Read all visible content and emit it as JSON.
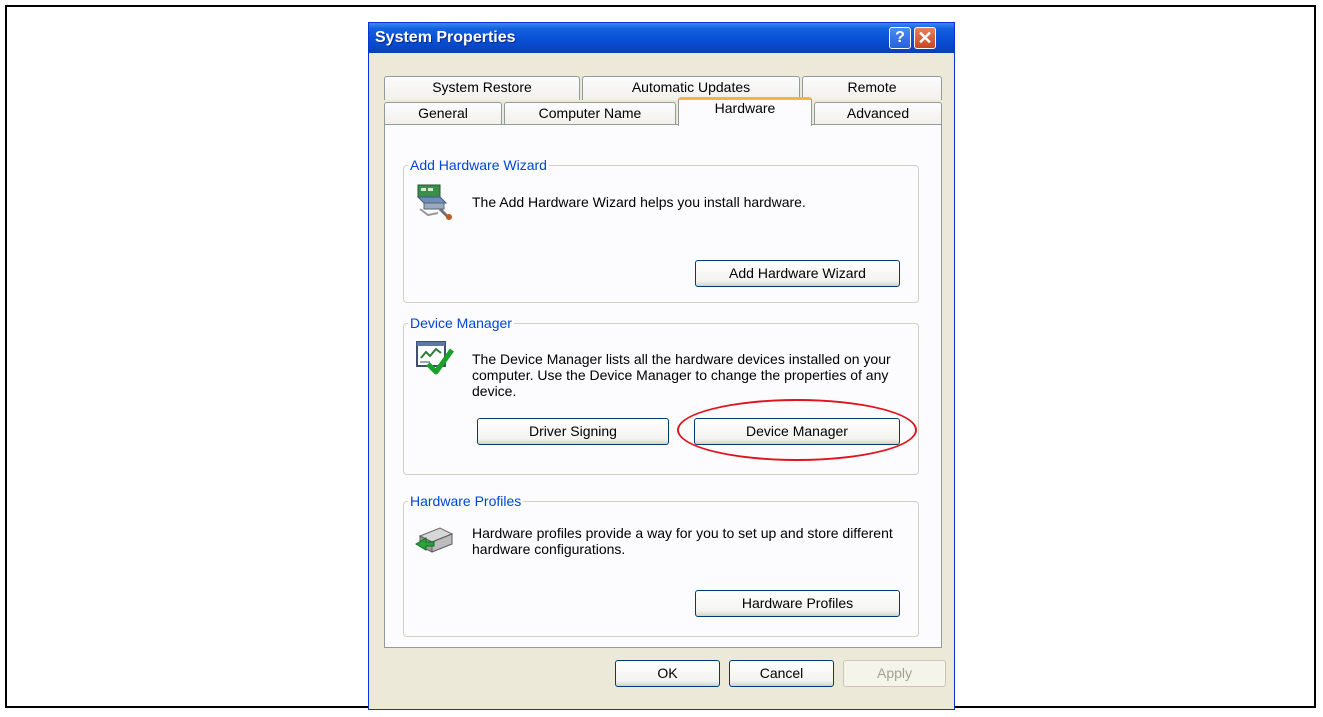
{
  "window": {
    "title": "System Properties",
    "help_glyph": "?",
    "close_glyph": "✕"
  },
  "tabs": {
    "row1": [
      "System Restore",
      "Automatic Updates",
      "Remote"
    ],
    "row2": [
      "General",
      "Computer Name",
      "Hardware",
      "Advanced"
    ],
    "active": "Hardware"
  },
  "add_hardware": {
    "group_label": "Add Hardware Wizard",
    "description": "The Add Hardware Wizard helps you install hardware.",
    "button_label": "Add Hardware Wizard",
    "icon": "add-hardware-icon"
  },
  "device_manager": {
    "group_label": "Device Manager",
    "description": "The Device Manager lists all the hardware devices installed on your computer. Use the Device Manager to change the properties of any device.",
    "driver_signing_label": "Driver Signing",
    "device_manager_label": "Device Manager",
    "icon": "device-manager-icon"
  },
  "hardware_profiles": {
    "group_label": "Hardware Profiles",
    "description": "Hardware profiles provide a way for you to set up and store different hardware configurations.",
    "button_label": "Hardware Profiles",
    "icon": "hardware-profiles-icon"
  },
  "footer": {
    "ok_label": "OK",
    "cancel_label": "Cancel",
    "apply_label": "Apply"
  },
  "colors": {
    "title_bar": "#0a52d8",
    "active_tab_accent": "#f7b33e",
    "group_label": "#0046d5",
    "highlight": "#e0141e"
  }
}
